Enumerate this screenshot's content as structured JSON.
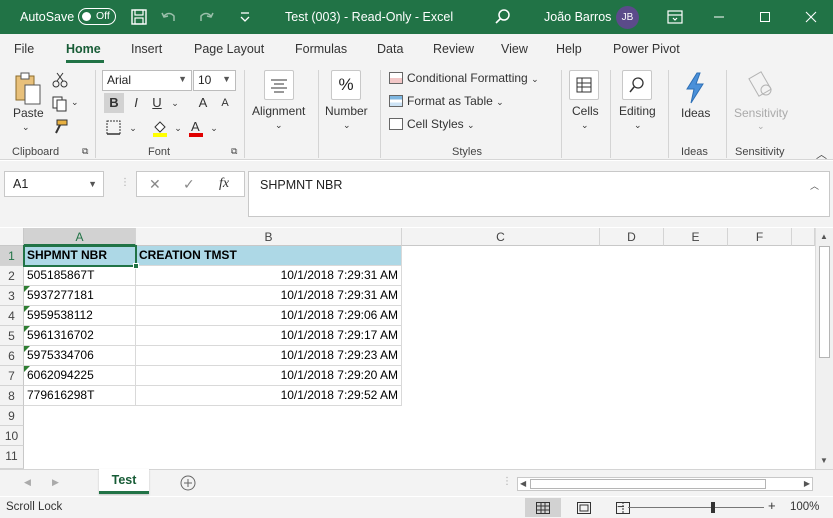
{
  "titlebar": {
    "autosave_label": "AutoSave",
    "autosave_state": "Off",
    "document_title": "Test (003)  -  Read-Only  -  Excel",
    "user_name": "João Barros",
    "user_initials": "JB"
  },
  "tabs": [
    "File",
    "Home",
    "Insert",
    "Page Layout",
    "Formulas",
    "Data",
    "Review",
    "View",
    "Help",
    "Power Pivot"
  ],
  "active_tab": "Home",
  "ribbon": {
    "clipboard": {
      "paste": "Paste",
      "label": "Clipboard"
    },
    "font": {
      "name": "Arial",
      "size": "10",
      "label": "Font",
      "bold": "B",
      "italic": "I",
      "underline": "U",
      "grow": "A",
      "shrink": "A"
    },
    "alignment": {
      "label": "Alignment"
    },
    "number": {
      "label": "Number",
      "icon_text": "%"
    },
    "styles": {
      "conditional_formatting": "Conditional Formatting",
      "format_as_table": "Format as Table",
      "cell_styles": "Cell Styles",
      "label": "Styles"
    },
    "cells": {
      "label": "Cells"
    },
    "editing": {
      "label": "Editing"
    },
    "ideas": {
      "button": "Ideas",
      "label": "Ideas"
    },
    "sensitivity": {
      "button": "Sensitivity",
      "label": "Sensitivity"
    }
  },
  "formula_bar": {
    "name_box": "A1",
    "fx": "fx",
    "content": "SHPMNT NBR"
  },
  "grid": {
    "columns": [
      "A",
      "B",
      "C",
      "D",
      "E",
      "F"
    ],
    "rows": [
      "1",
      "2",
      "3",
      "4",
      "5",
      "6",
      "7",
      "8",
      "9",
      "10",
      "11"
    ],
    "headers": [
      "SHPMNT NBR",
      "CREATION TMST"
    ],
    "data": [
      [
        "505185867T",
        "10/1/2018 7:29:31 AM"
      ],
      [
        "5937277181",
        "10/1/2018 7:29:31 AM"
      ],
      [
        "5959538112",
        "10/1/2018 7:29:06 AM"
      ],
      [
        "5961316702",
        "10/1/2018 7:29:17 AM"
      ],
      [
        "5975334706",
        "10/1/2018 7:29:23 AM"
      ],
      [
        "6062094225",
        "10/1/2018 7:29:20 AM"
      ],
      [
        "779616298T",
        "10/1/2018 7:29:52 AM"
      ]
    ]
  },
  "sheets": [
    "Test"
  ],
  "status": {
    "left": "Scroll Lock",
    "zoom": "100%"
  },
  "colors": {
    "accent": "#217346",
    "header_fill": "#add8e6"
  }
}
